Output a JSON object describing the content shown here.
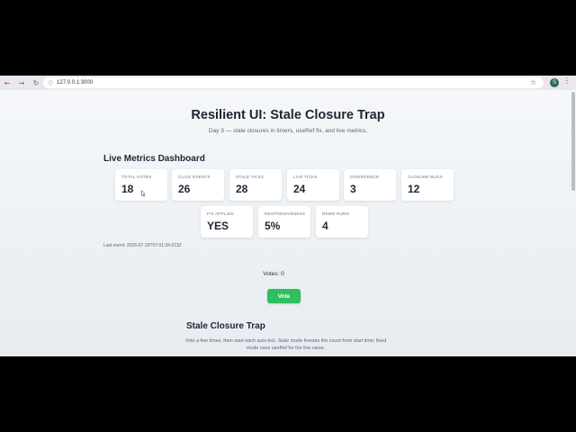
{
  "browser": {
    "url": "127.0.0.1:3000",
    "back_icon": "←",
    "forward_icon": "→",
    "reload_icon": "↻",
    "info_icon": "ⓘ",
    "star_icon": "☆",
    "profile_initial": "S",
    "menu_icon": "⋮"
  },
  "header": {
    "title": "Resilient UI: Stale Closure Trap",
    "subtitle": "Day 3 — stale closures in timers, useRef fix, and live metrics."
  },
  "dashboard": {
    "title": "Live Metrics Dashboard",
    "metrics": [
      {
        "label": "TOTAL VOTES",
        "value": "18"
      },
      {
        "label": "CLICK EVENTS",
        "value": "26"
      },
      {
        "label": "STALE TICKS",
        "value": "28"
      },
      {
        "label": "LIVE TICKS",
        "value": "24"
      },
      {
        "label": "DIVERGENCE",
        "value": "3"
      },
      {
        "label": "CLOSURE BUGS",
        "value": "12"
      },
      {
        "label": "FIX APPLIED",
        "value": "YES"
      },
      {
        "label": "RESPONSIVENESS",
        "value": "5%"
      },
      {
        "label": "DEMO RUNS",
        "value": "4"
      }
    ],
    "last_event": "Last event: 2026-07-29T07:01:34.613Z"
  },
  "votes": {
    "label": "Votes: 0",
    "button_label": "Vote"
  },
  "trap": {
    "title": "Stale Closure Trap",
    "description": "Vote a few times, then start each auto-tick. Stale mode freezes the count from start time; fixed mode uses useRef for the live value."
  },
  "colors": {
    "vote_button": "#2fbf5f",
    "title_text": "#1e2633",
    "browser_bar": "#ece6f0"
  }
}
